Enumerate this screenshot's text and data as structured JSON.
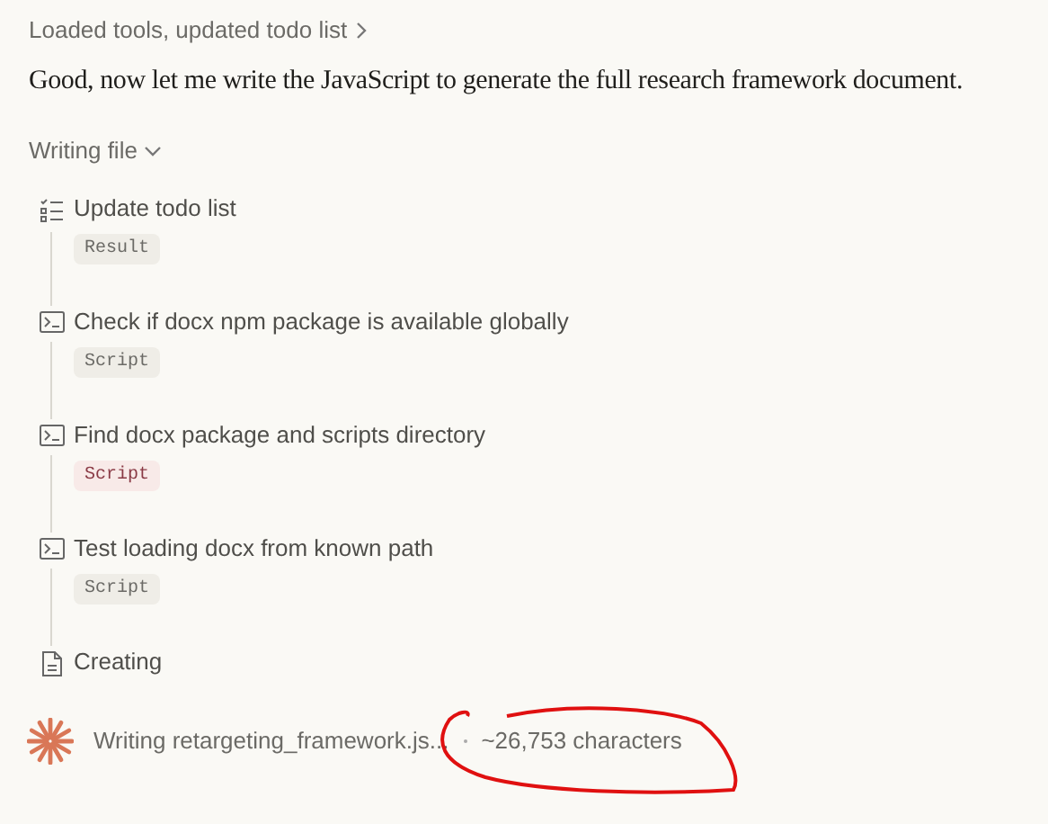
{
  "summary": {
    "label": "Loaded tools, updated todo list",
    "expanded": false
  },
  "message": "Good, now let me write the JavaScript to generate the full research framework document.",
  "section": {
    "label": "Writing file",
    "expanded": true
  },
  "steps": [
    {
      "kind": "todo",
      "label": "Update todo list",
      "badge": "Result",
      "error": false
    },
    {
      "kind": "terminal",
      "label": "Check if docx npm package is available globally",
      "badge": "Script",
      "error": false
    },
    {
      "kind": "terminal",
      "label": "Find docx package and scripts directory",
      "badge": "Script",
      "error": true
    },
    {
      "kind": "terminal",
      "label": "Test loading docx from known path",
      "badge": "Script",
      "error": false
    },
    {
      "kind": "file",
      "label": "Creating"
    }
  ],
  "progress": {
    "label": "Writing retargeting_framework.js...",
    "detail": "~26,753 characters"
  },
  "annotation": {
    "kind": "circle"
  }
}
